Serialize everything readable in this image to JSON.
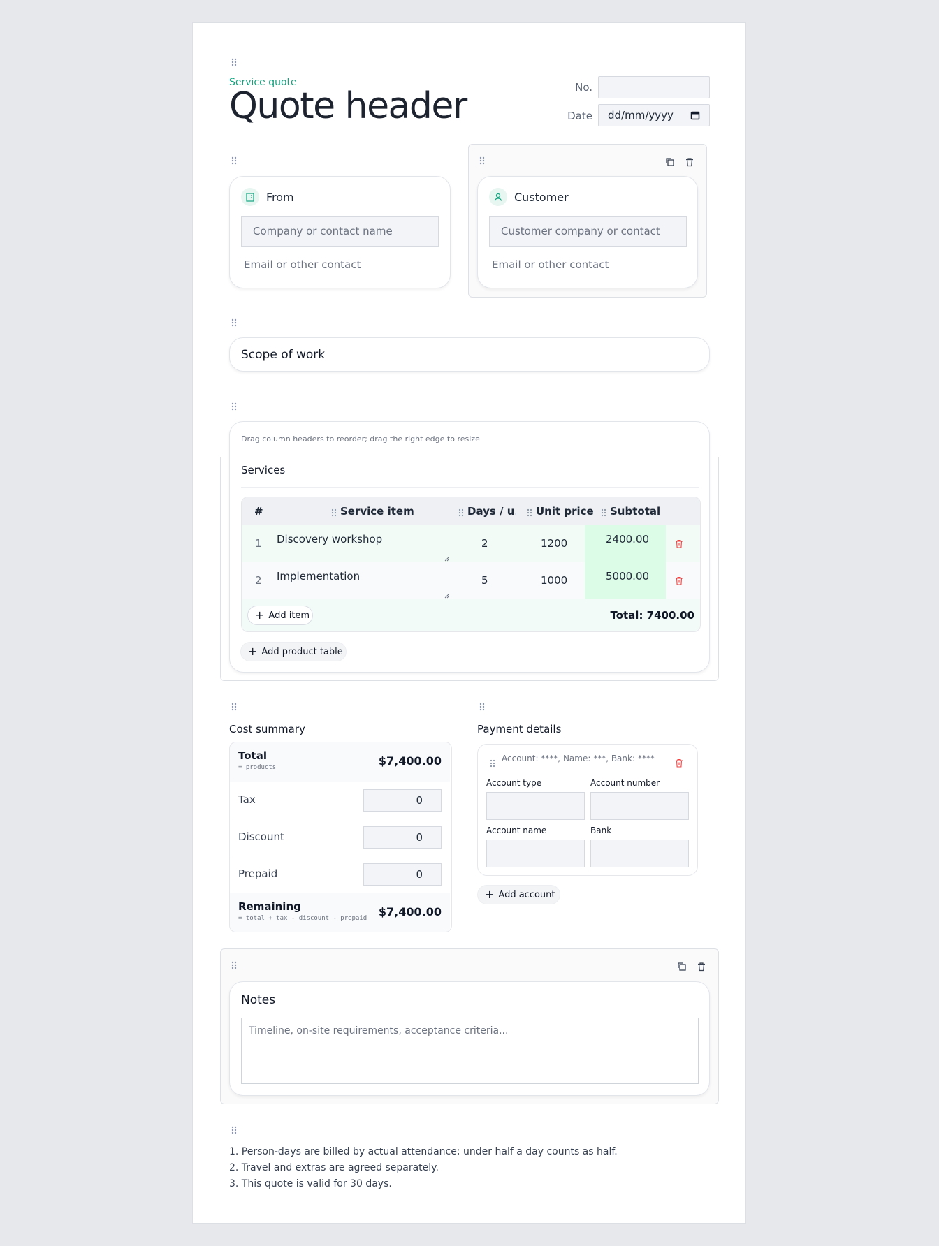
{
  "header": {
    "eyebrow": "Service quote",
    "title": "Quote header",
    "no_label": "No.",
    "no_value": "",
    "date_label": "Date",
    "date_value": "dd/mm/yyyy"
  },
  "from_card": {
    "title": "From",
    "name_placeholder": "Company or contact name",
    "contact_placeholder": "Email or other contact"
  },
  "customer_card": {
    "title": "Customer",
    "name_placeholder": "Customer company or contact",
    "contact_placeholder": "Email or other contact"
  },
  "scope": {
    "title": "Scope of work"
  },
  "services": {
    "hint": "Drag column headers to reorder; drag the right edge to resize",
    "title": "Services",
    "columns": [
      "#",
      "Service item",
      "Days / u...",
      "Unit price",
      "Subtotal"
    ],
    "rows": [
      {
        "num": "1",
        "item": "Discovery workshop",
        "days": "2",
        "price": "1200",
        "subtotal": "2400.00"
      },
      {
        "num": "2",
        "item": "Implementation",
        "days": "5",
        "price": "1000",
        "subtotal": "5000.00"
      }
    ],
    "add_item": "Add item",
    "total": "Total: 7400.00",
    "add_table": "Add product table"
  },
  "cost_summary": {
    "title": "Cost summary",
    "total_label": "Total",
    "total_sub": "= products",
    "total_value": "$7,400.00",
    "tax_label": "Tax",
    "tax_value": "0",
    "discount_label": "Discount",
    "discount_value": "0",
    "prepaid_label": "Prepaid",
    "prepaid_value": "0",
    "remaining_label": "Remaining",
    "remaining_sub": "= total + tax - discount - prepaid",
    "remaining_value": "$7,400.00"
  },
  "payment": {
    "title": "Payment details",
    "account_summary": "Account: ****, Name: ***, Bank: ****",
    "account_type_label": "Account type",
    "account_number_label": "Account number",
    "account_name_label": "Account name",
    "bank_label": "Bank",
    "add_account": "Add account"
  },
  "notes": {
    "title": "Notes",
    "placeholder": "Timeline, on-site requirements, acceptance criteria..."
  },
  "terms": [
    "1. Person-days are billed by actual attendance; under half a day counts as half.",
    "2. Travel and extras are agreed separately.",
    "3. This quote is valid for 30 days."
  ],
  "colors": {
    "accent": "#14a37f",
    "subtotal_bg": "#dcfce7",
    "row_bg": "#f3fbf6",
    "delete": "#ef4444",
    "background": "#e6e8ec"
  }
}
